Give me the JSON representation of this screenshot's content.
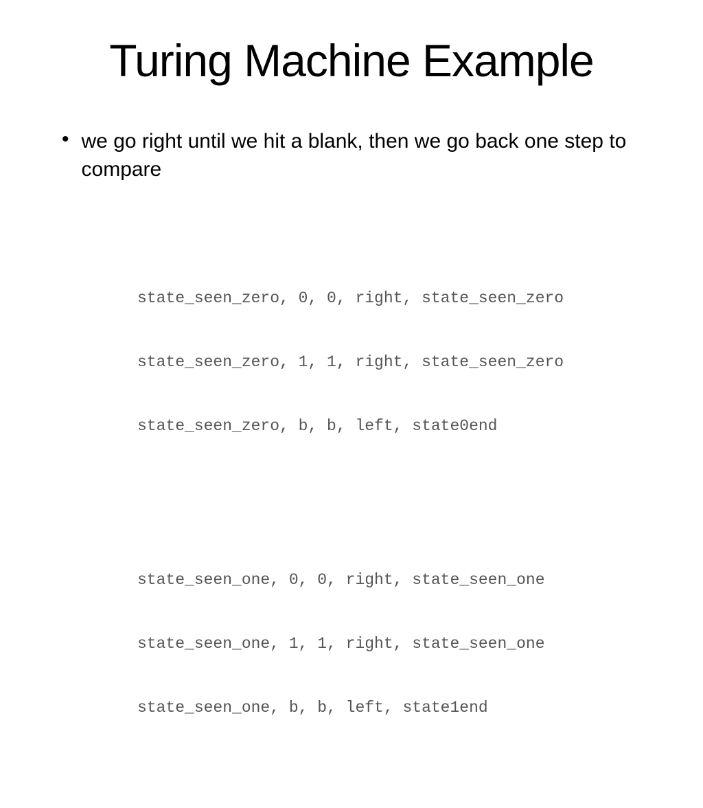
{
  "slide": {
    "title": "Turing Machine Example",
    "bullet": "we go right until we hit a blank, then we go back one step to compare",
    "code_group_1": {
      "line1": "state_seen_zero, 0, 0, right, state_seen_zero",
      "line2": "state_seen_zero, 1, 1, right, state_seen_zero",
      "line3": "state_seen_zero, b, b, left, state0end"
    },
    "code_group_2": {
      "line1": "state_seen_one, 0, 0, right, state_seen_one",
      "line2": "state_seen_one, 1, 1, right, state_seen_one",
      "line3": "state_seen_one, b, b, left, state1end"
    }
  }
}
